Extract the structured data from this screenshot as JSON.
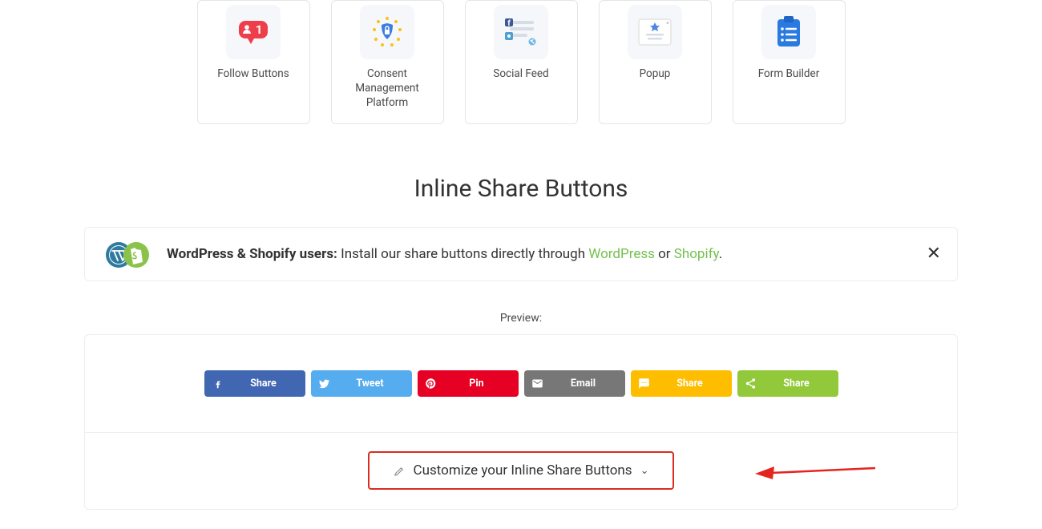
{
  "tools": [
    {
      "name": "follow-buttons",
      "label": "Follow Buttons"
    },
    {
      "name": "consent-management",
      "label": "Consent Management Platform"
    },
    {
      "name": "social-feed",
      "label": "Social Feed"
    },
    {
      "name": "popup",
      "label": "Popup"
    },
    {
      "name": "form-builder",
      "label": "Form Builder"
    }
  ],
  "section_title": "Inline Share Buttons",
  "notice": {
    "bold": "WordPress & Shopify users:",
    "text_before": " Install our share buttons directly through ",
    "wp": "WordPress",
    "or": " or ",
    "shopify": "Shopify",
    "period": "."
  },
  "preview_label": "Preview:",
  "share_buttons": {
    "facebook": "Share",
    "twitter": "Tweet",
    "pinterest": "Pin",
    "email": "Email",
    "sms": "Share",
    "sharethis": "Share"
  },
  "customize_label": "Customize your Inline Share Buttons"
}
